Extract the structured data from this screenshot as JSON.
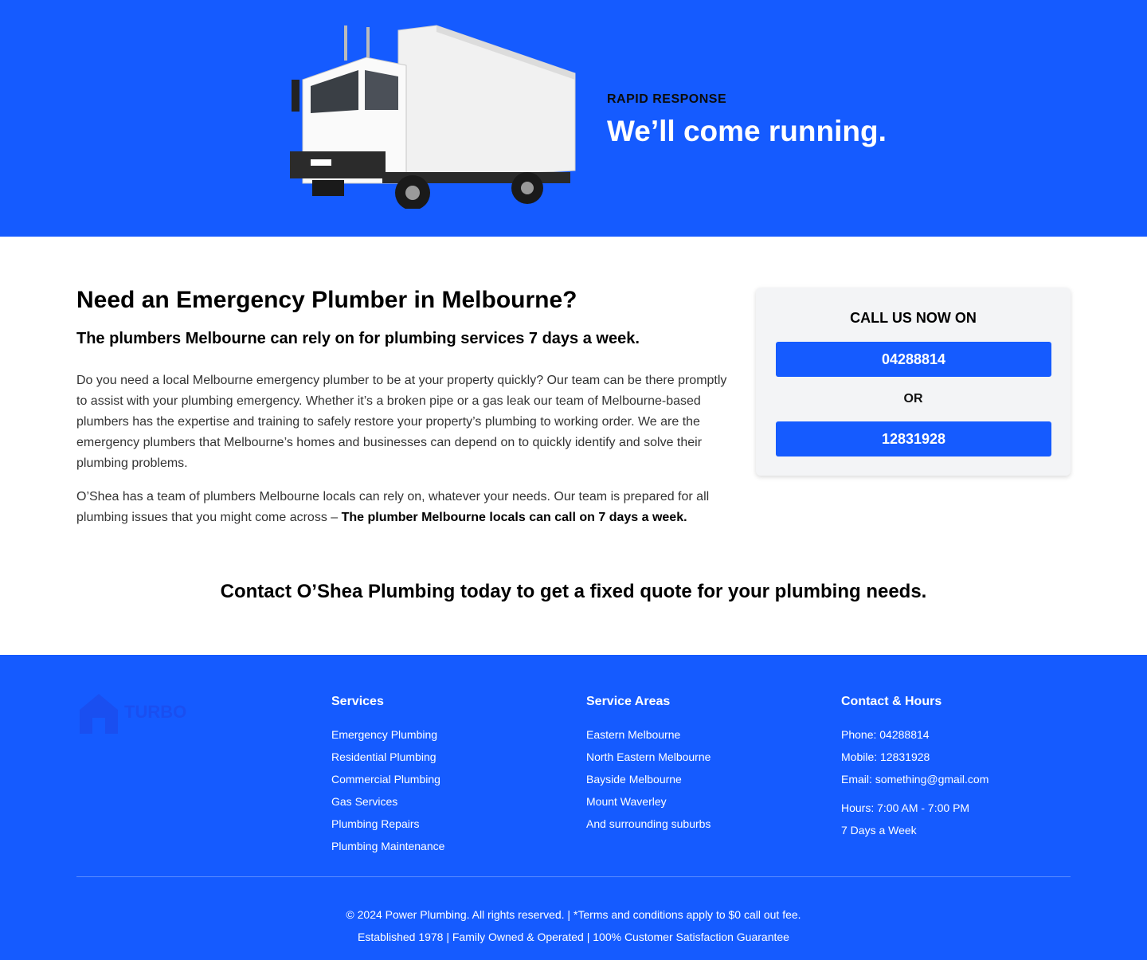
{
  "hero": {
    "eyebrow": "RAPID RESPONSE",
    "title": "We’ll come running."
  },
  "main": {
    "heading": "Need an Emergency Plumber in Melbourne?",
    "subheading": "The plumbers Melbourne can rely on for plumbing services 7 days a week.",
    "para1": "Do you need a local Melbourne emergency plumber to be at your property quickly? Our team can be there promptly to assist with your plumbing emergency. Whether it’s a broken pipe or a gas leak our team of Melbourne-based plumbers has the expertise and training to safely restore your property’s plumbing to working order. We are the emergency plumbers that Melbourne’s homes and businesses can depend on to quickly identify and solve their plumbing problems.",
    "para2_text": "O’Shea has a team of plumbers Melbourne locals can rely on, whatever your needs. Our team is prepared for all plumbing issues that you might come across – ",
    "para2_bold": "The plumber Melbourne locals can call on 7 days a week.",
    "cta": "Contact O’Shea Plumbing today to get a fixed quote for your plumbing needs."
  },
  "call_card": {
    "title": "CALL US NOW ON",
    "phone1": "04288814",
    "or": "OR",
    "phone2": "12831928"
  },
  "footer": {
    "services": {
      "title": "Services",
      "items": [
        "Emergency Plumbing",
        "Residential Plumbing",
        "Commercial Plumbing",
        "Gas Services",
        "Plumbing Repairs",
        "Plumbing Maintenance"
      ]
    },
    "areas": {
      "title": "Service Areas",
      "items": [
        "Eastern Melbourne",
        "North Eastern Melbourne",
        "Bayside Melbourne",
        "Mount Waverley",
        "And surrounding suburbs"
      ]
    },
    "contact": {
      "title": "Contact & Hours",
      "phone": "Phone: 04288814",
      "mobile": "Mobile: 12831928",
      "email": "Email: something@gmail.com",
      "hours": "Hours: 7:00 AM - 7:00 PM",
      "days": "7 Days a Week"
    },
    "logo_text": "TURBO",
    "copyright": "© 2024 Power Plumbing. All rights reserved. | *Terms and conditions apply to $0 call out fee.",
    "tagline": "Established 1978 | Family Owned & Operated | 100% Customer Satisfaction Guarantee"
  },
  "colors": {
    "brand_blue": "#155bff",
    "card_bg": "#f3f4f6"
  }
}
